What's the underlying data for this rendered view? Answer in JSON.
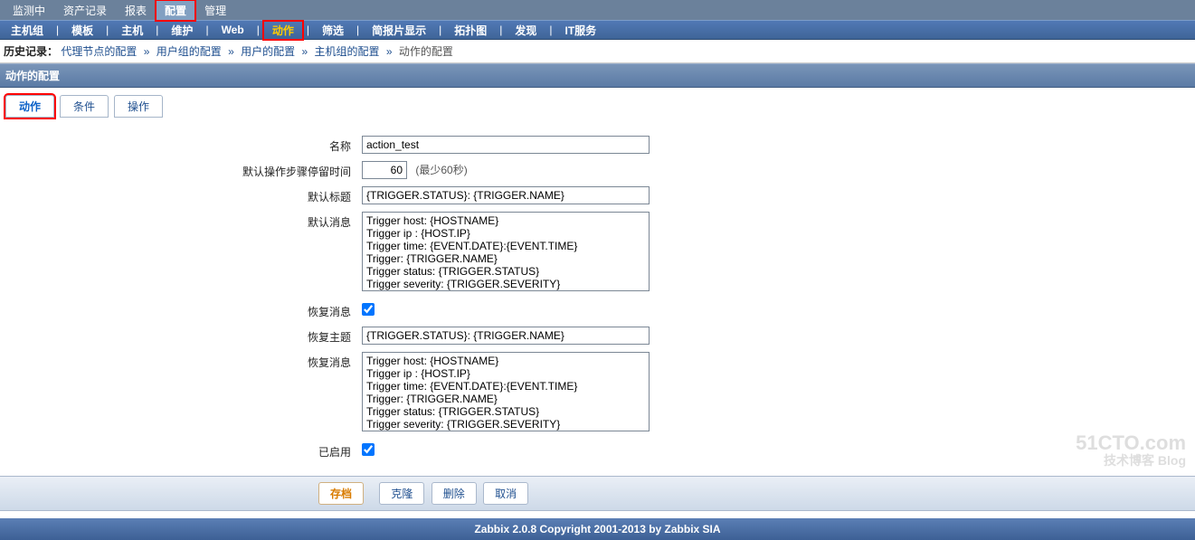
{
  "top_nav": {
    "items": [
      "监测中",
      "资产记录",
      "报表",
      "配置",
      "管理"
    ],
    "active_index": 3,
    "highlight_index": 3
  },
  "sub_nav": {
    "items": [
      "主机组",
      "模板",
      "主机",
      "维护",
      "Web",
      "动作",
      "筛选",
      "简报片显示",
      "拓扑图",
      "发现",
      "IT服务"
    ],
    "active_index": 5,
    "highlight_index": 5,
    "separator": "|"
  },
  "breadcrumb": {
    "label": "历史记录：",
    "items": [
      "代理节点的配置",
      "用户组的配置",
      "用户的配置",
      "主机组的配置",
      "动作的配置"
    ],
    "separator": "»"
  },
  "page_title": "动作的配置",
  "tabs": {
    "items": [
      "动作",
      "条件",
      "操作"
    ],
    "active_index": 0,
    "highlight_index": 0
  },
  "form": {
    "name_label": "名称",
    "name_value": "action_test",
    "step_label": "默认操作步骤停留时间",
    "step_value": "60",
    "step_hint": "(最少60秒)",
    "subject_label": "默认标题",
    "subject_value": "{TRIGGER.STATUS}: {TRIGGER.NAME}",
    "message_label": "默认消息",
    "message_value": "Trigger host: {HOSTNAME}\nTrigger ip : {HOST.IP}\nTrigger time: {EVENT.DATE}:{EVENT.TIME}\nTrigger: {TRIGGER.NAME}\nTrigger status: {TRIGGER.STATUS}\nTrigger severity: {TRIGGER.SEVERITY}\nTrigger URL: {TRIGGER.URL}",
    "recovery_msg_label": "恢复消息",
    "recovery_msg_checked": true,
    "recovery_subject_label": "恢复主题",
    "recovery_subject_value": "{TRIGGER.STATUS}: {TRIGGER.NAME}",
    "recovery_message_label": "恢复消息",
    "recovery_message_value": "Trigger host: {HOSTNAME}\nTrigger ip : {HOST.IP}\nTrigger time: {EVENT.DATE}:{EVENT.TIME}\nTrigger: {TRIGGER.NAME}\nTrigger status: {TRIGGER.STATUS}\nTrigger severity: {TRIGGER.SEVERITY}\nTrigger URL: {TRIGGER.URL}",
    "enabled_label": "已启用",
    "enabled_checked": true
  },
  "footer": {
    "save": "存档",
    "clone": "克隆",
    "delete": "删除",
    "cancel": "取消"
  },
  "copyright": "Zabbix 2.0.8 Copyright 2001-2013 by Zabbix SIA",
  "watermark": {
    "line1": "51CTO.com",
    "line2": "技术博客 Blog"
  }
}
